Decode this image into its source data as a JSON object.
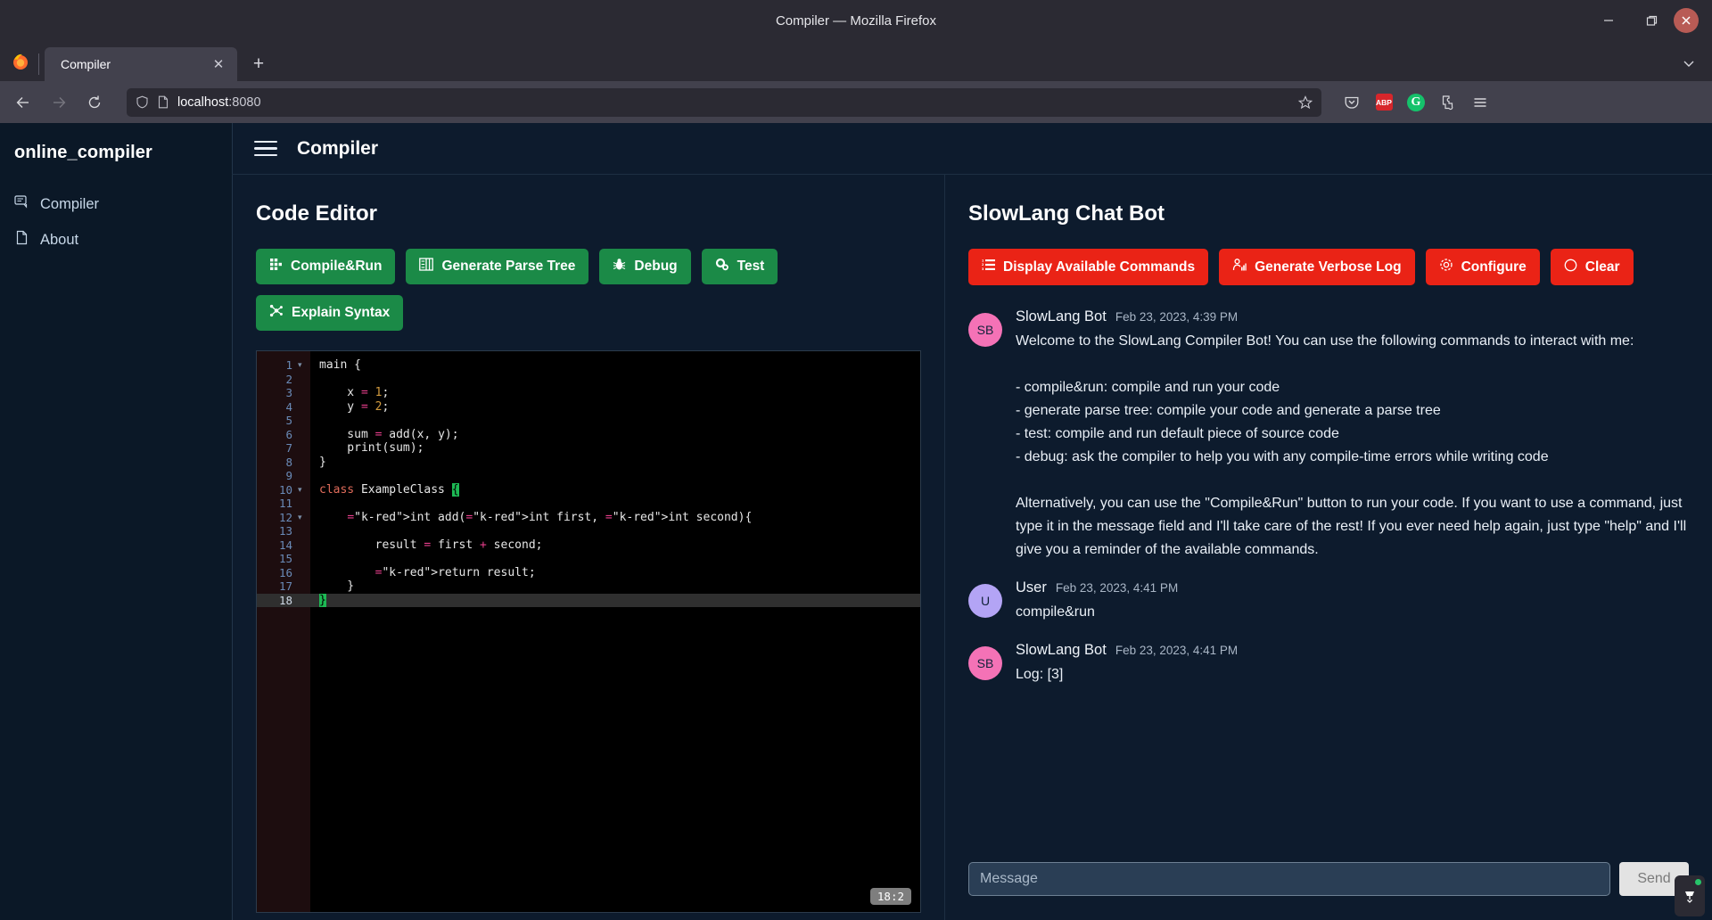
{
  "browser": {
    "window_title": "Compiler — Mozilla Firefox",
    "tab_title": "Compiler",
    "url_host": "localhost",
    "url_port": ":8080",
    "minimize": "–",
    "maximize": "❐",
    "close": "✕",
    "tab_close": "✕",
    "new_tab": "+",
    "tab_list": "⌄",
    "back": "←",
    "forward": "→",
    "reload": "⟳",
    "bookmark": "☆",
    "abp_badge": "ABP",
    "grammarly_badge": "G"
  },
  "sidebar": {
    "brand": "online_compiler",
    "items": [
      {
        "label": "Compiler",
        "icon": "chat-bubble-icon"
      },
      {
        "label": "About",
        "icon": "document-icon"
      }
    ]
  },
  "topbar": {
    "title": "Compiler"
  },
  "editor_panel": {
    "title": "Code Editor",
    "buttons": [
      {
        "label": "Compile&Run",
        "icon": "grid-icon",
        "color": "#1b8a47"
      },
      {
        "label": "Generate Parse Tree",
        "icon": "tree-icon",
        "color": "#1b8a47"
      },
      {
        "label": "Debug",
        "icon": "bug-icon",
        "color": "#1b8a47"
      },
      {
        "label": "Test",
        "icon": "gears-icon",
        "color": "#1b8a47"
      },
      {
        "label": "Explain Syntax",
        "icon": "graph-nodes-icon",
        "color": "#1b8a47"
      }
    ],
    "cursor_position": "18:2",
    "line_numbers": [
      "1",
      "2",
      "3",
      "4",
      "5",
      "6",
      "7",
      "8",
      "9",
      "10",
      "11",
      "12",
      "13",
      "14",
      "15",
      "16",
      "17",
      "18"
    ],
    "fold_markers": {
      "1": "▾",
      "10": "▾",
      "12": "▾"
    },
    "active_line": 18,
    "code_lines": [
      "main {",
      "",
      "    x = 1;",
      "    y = 2;",
      "",
      "    sum = add(x, y);",
      "    print(sum);",
      "}",
      "",
      "class ExampleClass {",
      "",
      "    int add(int first, int second){",
      "",
      "        result = first + second;",
      "",
      "        return result;",
      "    }",
      "}"
    ]
  },
  "chat_panel": {
    "title": "SlowLang Chat Bot",
    "buttons": [
      {
        "label": "Display Available Commands",
        "icon": "list-icon",
        "color": "#ea2316"
      },
      {
        "label": "Generate Verbose Log",
        "icon": "analytics-icon",
        "color": "#ea2316"
      },
      {
        "label": "Configure",
        "icon": "gear-icon",
        "color": "#ea2316"
      },
      {
        "label": "Clear",
        "icon": "circle-icon",
        "color": "#ea2316"
      }
    ],
    "messages": [
      {
        "author": "SlowLang Bot",
        "initials": "SB",
        "avatar_color": "#f472b6",
        "time": "Feb 23, 2023, 4:39 PM",
        "lines": [
          "Welcome to the SlowLang Compiler Bot! You can use the following commands to interact with me:",
          "",
          "- compile&run: compile and run your code",
          "- generate parse tree: compile your code and generate a parse tree",
          "- test: compile and run default piece of source code",
          "- debug: ask the compiler to help you with any compile-time errors while writing code",
          "",
          "Alternatively, you can use the \"Compile&Run\" button to run your code. If you want to use a command, just type it in the message field and I'll take care of the rest! If you ever need help again, just type \"help\" and I'll give you a reminder of the available commands."
        ]
      },
      {
        "author": "User",
        "initials": "U",
        "avatar_color": "#b3a4f5",
        "time": "Feb 23, 2023, 4:41 PM",
        "lines": [
          "compile&run"
        ]
      },
      {
        "author": "SlowLang Bot",
        "initials": "SB",
        "avatar_color": "#f472b6",
        "time": "Feb 23, 2023, 4:41 PM",
        "lines": [
          "Log: [3]"
        ]
      }
    ],
    "composer": {
      "placeholder": "Message",
      "value": "",
      "send_label": "Send"
    }
  }
}
